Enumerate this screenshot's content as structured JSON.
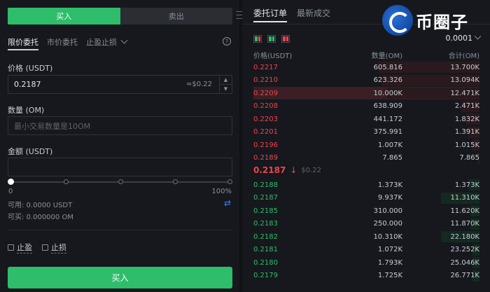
{
  "form": {
    "buy_tab": "买入",
    "sell_tab": "卖出",
    "order_types": [
      "限价委托",
      "市价委托",
      "止盈止损"
    ],
    "price_label": "价格 (USDT)",
    "price_value": "0.2187",
    "price_hint": "≈$0.22",
    "qty_label": "数量 (OM)",
    "qty_placeholder": "最小交易数量是10OM",
    "amount_label": "金额 (USDT)",
    "slider_min": "0",
    "slider_max": "100%",
    "slider_percent": 0,
    "available": "可用: 0.0000 USDT",
    "buyable": "可买: 0.000000 OM",
    "take_profit": "止盈",
    "stop_loss": "止损",
    "submit": "买入"
  },
  "book": {
    "tab_orders": "委托订单",
    "tab_trades": "最新成交",
    "logo_text": "币圈子",
    "precision": "0.0001",
    "headers": [
      "价格(USDT)",
      "数量(OM)",
      "合计(OM)"
    ],
    "asks": [
      {
        "price": "0.2217",
        "qty": "605.816",
        "total": "13.700K",
        "depth": 0.45
      },
      {
        "price": "0.2210",
        "qty": "623.326",
        "total": "13.094K",
        "depth": 0.43
      },
      {
        "price": "0.2209",
        "qty": "10.000K",
        "total": "12.471K",
        "depth": 0.41
      },
      {
        "price": "0.2208",
        "qty": "638.909",
        "total": "2.471K",
        "depth": 0.08
      },
      {
        "price": "0.2203",
        "qty": "441.172",
        "total": "1.832K",
        "depth": 0.06
      },
      {
        "price": "0.2201",
        "qty": "375.991",
        "total": "1.391K",
        "depth": 0.05
      },
      {
        "price": "0.2196",
        "qty": "1.007K",
        "total": "1.015K",
        "depth": 0.03
      },
      {
        "price": "0.2189",
        "qty": "7.865",
        "total": "7.865",
        "depth": 0.01
      }
    ],
    "last_price": "0.2187",
    "last_price_usd": "$0.22",
    "bids": [
      {
        "price": "0.2188",
        "qty": "1.373K",
        "total": "1.373K",
        "depth": 0.05
      },
      {
        "price": "0.2187",
        "qty": "9.937K",
        "total": "11.310K",
        "depth": 0.17
      },
      {
        "price": "0.2185",
        "qty": "310.000",
        "total": "11.620K",
        "depth": 0.04
      },
      {
        "price": "0.2183",
        "qty": "250.000",
        "total": "11.870K",
        "depth": 0.04
      },
      {
        "price": "0.2182",
        "qty": "10.310K",
        "total": "22.180K",
        "depth": 0.17
      },
      {
        "price": "0.2181",
        "qty": "1.072K",
        "total": "23.252K",
        "depth": 0.03
      },
      {
        "price": "0.2180",
        "qty": "1.793K",
        "total": "25.046K",
        "depth": 0.03
      },
      {
        "price": "0.2179",
        "qty": "1.725K",
        "total": "26.771K",
        "depth": 0.03
      }
    ]
  }
}
